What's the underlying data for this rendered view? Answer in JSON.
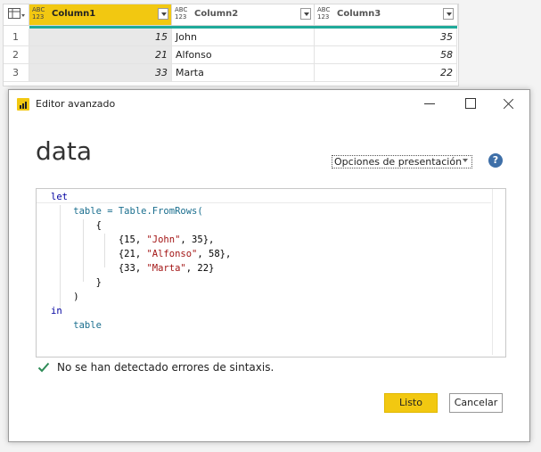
{
  "grid": {
    "headers": [
      {
        "type_line1": "ABC",
        "type_line2": "123",
        "name": "Column1"
      },
      {
        "type_line1": "ABC",
        "type_line2": "123",
        "name": "Column2"
      },
      {
        "type_line1": "ABC",
        "type_line2": "123",
        "name": "Column3"
      }
    ],
    "rows": [
      {
        "num": "1",
        "c1": "15",
        "c2": "John",
        "c3": "35"
      },
      {
        "num": "2",
        "c1": "21",
        "c2": "Alfonso",
        "c3": "58"
      },
      {
        "num": "3",
        "c1": "33",
        "c2": "Marta",
        "c3": "22"
      }
    ]
  },
  "dialog": {
    "title": "Editor avanzado",
    "query_name": "data",
    "options_label": "Opciones de presentación",
    "help": "?",
    "code_lines": [
      "let",
      "    table = Table.FromRows(",
      "        {",
      "            {15, \"John\", 35},",
      "            {21, \"Alfonso\", 58},",
      "            {33, \"Marta\", 22}",
      "        }",
      "    )",
      "in",
      "    table"
    ],
    "status": "No se han detectado errores de sintaxis.",
    "ok_label": "Listo",
    "cancel_label": "Cancelar"
  },
  "colors": {
    "accent_yellow": "#f2c811",
    "teal_bar": "#1faa9a",
    "check_green": "#2e8b57",
    "help_blue": "#3e6fa8"
  }
}
